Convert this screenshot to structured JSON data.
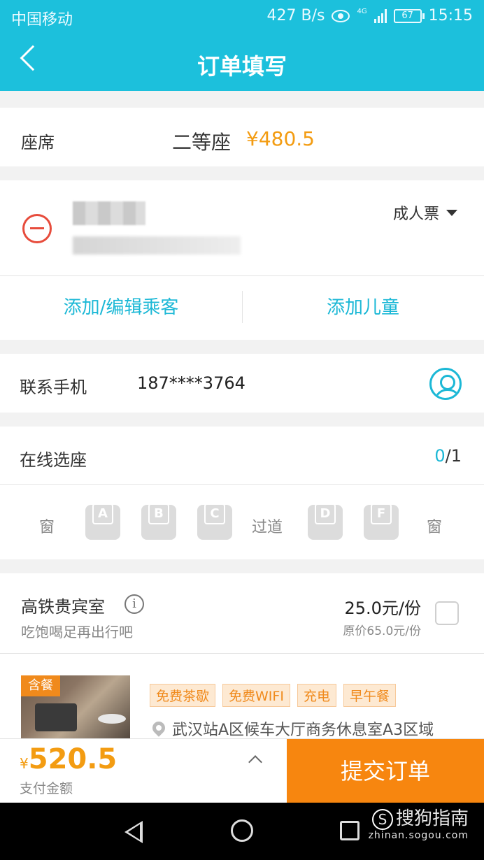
{
  "status_bar": {
    "carrier": "中国移动",
    "speed": "427 B/s",
    "network": "4G",
    "battery": "67",
    "time": "15:15"
  },
  "header": {
    "title": "订单填写"
  },
  "seat": {
    "label": "座席",
    "class": "二等座",
    "price": "¥480.5"
  },
  "passenger": {
    "ticket_type": "成人票",
    "add_edit_label": "添加/编辑乘客",
    "add_child_label": "添加儿童"
  },
  "contact": {
    "label": "联系手机",
    "phone": "187****3764"
  },
  "seat_select": {
    "label": "在线选座",
    "selected": "0",
    "total": "/1",
    "row": {
      "window_left": "窗",
      "aisle": "过道",
      "window_right": "窗",
      "seats": [
        "A",
        "B",
        "C",
        "D",
        "F"
      ]
    }
  },
  "lounge": {
    "title": "高铁贵宾室",
    "info_glyph": "i",
    "subtitle": "吃饱喝足再出行吧",
    "price": "25.0元/份",
    "original_price": "原价65.0元/份",
    "badge": "含餐",
    "tags": [
      "免费茶歇",
      "免费WIFI",
      "充电",
      "早午餐"
    ],
    "address": "武汉站A区候车大厅商务休息室A3区域"
  },
  "bottom": {
    "currency": "¥",
    "amount": "520.5",
    "amount_label": "支付金额",
    "submit_label": "提交订单"
  },
  "watermark": {
    "logo": "S",
    "brand": "搜狗指南",
    "domain": "zhinan.sogou.com"
  },
  "colors": {
    "accent": "#1cc0dc",
    "price": "#f39c12",
    "submit": "#f7860f",
    "danger": "#e74c3c"
  }
}
